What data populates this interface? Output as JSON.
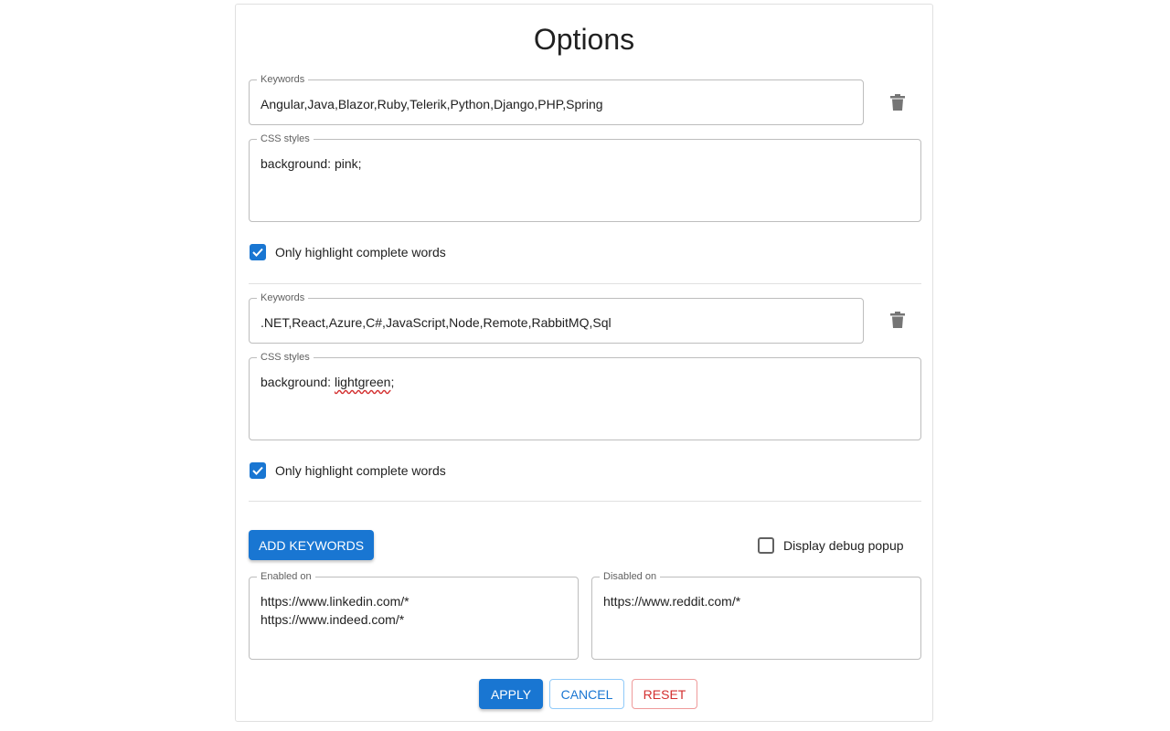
{
  "page": {
    "title": "Options"
  },
  "groups": [
    {
      "keywords_label": "Keywords",
      "keywords_value": "Angular,Java,Blazor,Ruby,Telerik,Python,Django,PHP,Spring",
      "css_label": "CSS styles",
      "css_value": "background: pink;",
      "complete_words_label": "Only highlight complete words",
      "complete_words_checked": true
    },
    {
      "keywords_label": "Keywords",
      "keywords_value": ".NET,React,Azure,C#,JavaScript,Node,Remote,RabbitMQ,Sql",
      "css_label": "CSS styles",
      "css_value_prefix": "background: ",
      "css_value_misspelled": "lightgreen",
      "css_value_suffix": ";",
      "complete_words_label": "Only highlight complete words",
      "complete_words_checked": true
    }
  ],
  "actions": {
    "add_keywords": "ADD KEYWORDS",
    "debug_popup_label": "Display debug popup",
    "debug_popup_checked": false
  },
  "sites": {
    "enabled_label": "Enabled on",
    "enabled_value": "https://www.linkedin.com/*\nhttps://www.indeed.com/*",
    "disabled_label": "Disabled on",
    "disabled_value": "https://www.reddit.com/*"
  },
  "footer": {
    "apply": "APPLY",
    "cancel": "CANCEL",
    "reset": "RESET"
  },
  "colors": {
    "primary": "#1976d2",
    "danger": "#d32f2f",
    "icon": "#757575"
  },
  "icons": {
    "delete": "trash-icon",
    "check": "checkmark-icon"
  }
}
